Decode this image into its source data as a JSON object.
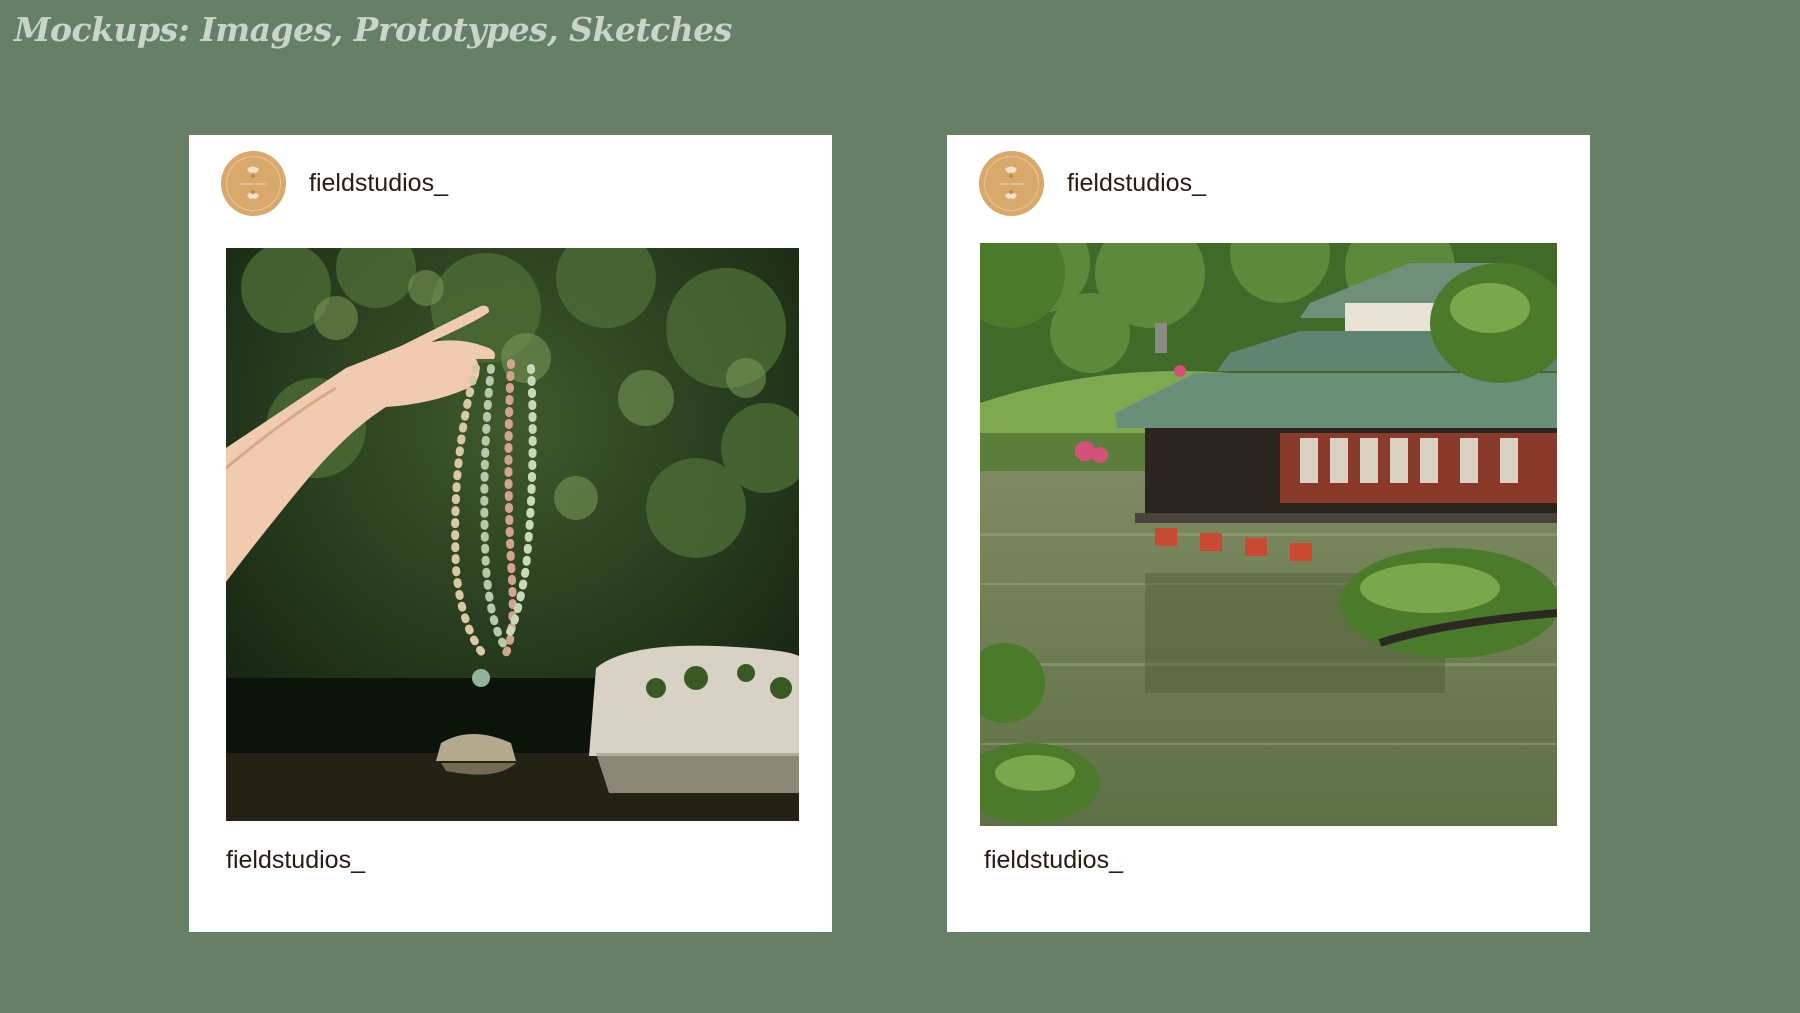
{
  "slide": {
    "title": "Mockups: Images, Prototypes, Sketches",
    "background_color": "#667f66"
  },
  "posts": [
    {
      "avatar_icon": "brand-logo-icon",
      "handle": "fieldstudios_",
      "caption_handle": "fieldstudios_",
      "image_subject": "hand holding beaded necklaces in forest"
    },
    {
      "avatar_icon": "brand-logo-icon",
      "handle": "fieldstudios_",
      "caption_handle": "fieldstudios_",
      "image_subject": "japanese teahouse over garden pond"
    }
  ]
}
